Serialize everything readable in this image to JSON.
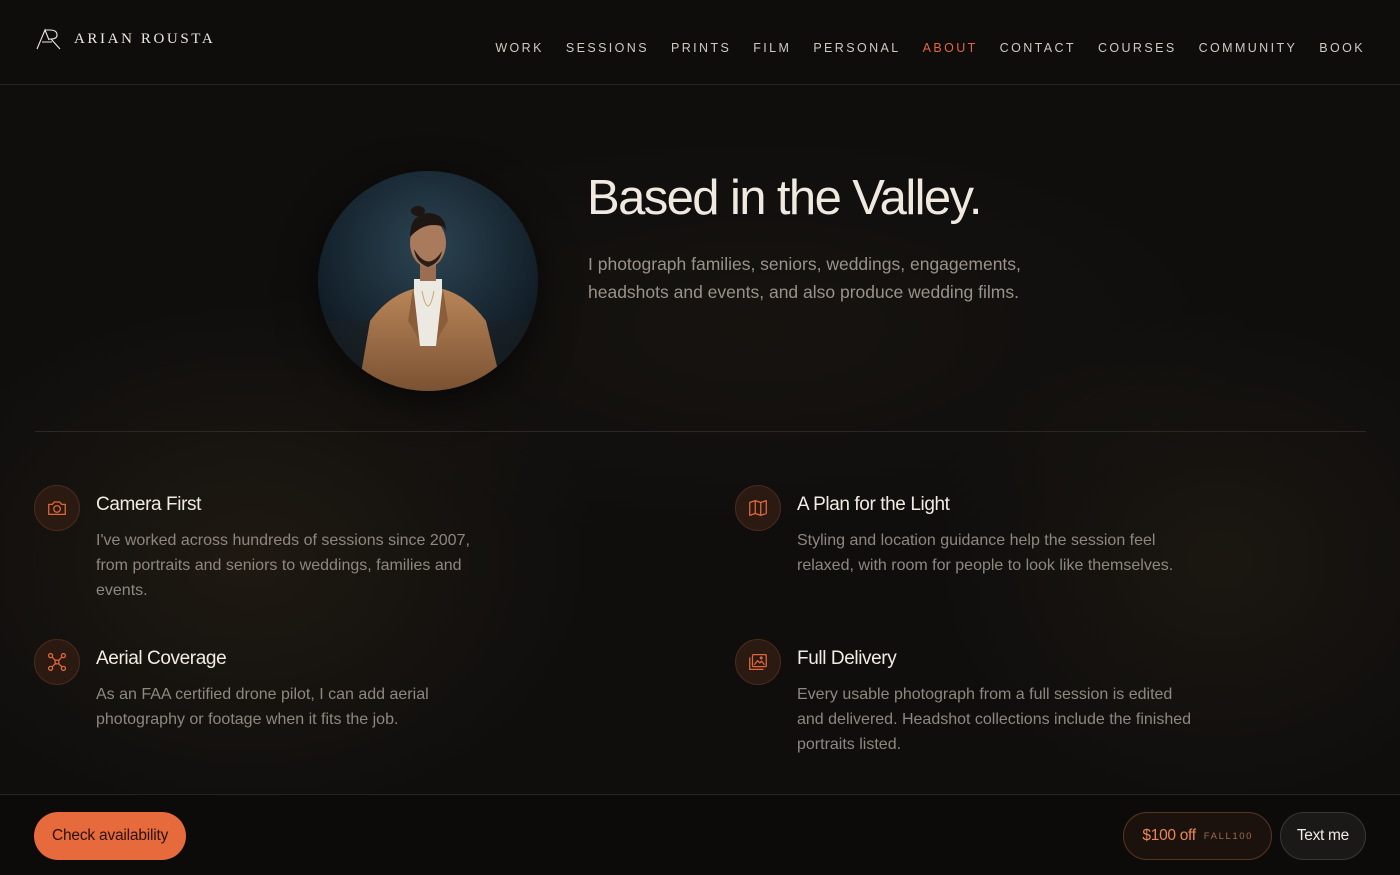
{
  "brand": {
    "name": "ARIAN ROUSTA",
    "logo_icon": "ar-monogram-icon"
  },
  "nav": {
    "items": [
      {
        "label": "WORK",
        "active": false
      },
      {
        "label": "SESSIONS",
        "active": false
      },
      {
        "label": "PRINTS",
        "active": false
      },
      {
        "label": "FILM",
        "active": false
      },
      {
        "label": "PERSONAL",
        "active": false
      },
      {
        "label": "ABOUT",
        "active": true
      },
      {
        "label": "CONTACT",
        "active": false
      },
      {
        "label": "COURSES",
        "active": false
      },
      {
        "label": "COMMUNITY",
        "active": false
      },
      {
        "label": "BOOK",
        "active": false
      }
    ],
    "active_color": "#e3673a"
  },
  "hero": {
    "title": "Based in the Valley.",
    "text": "I photograph families, seniors, weddings, engagements, headshots and events, and also produce wedding films."
  },
  "features": [
    {
      "icon": "camera-icon",
      "title": "Camera First",
      "text": "I've worked across hundreds of sessions since 2007, from portraits and seniors to weddings, families and events."
    },
    {
      "icon": "map-icon",
      "title": "A Plan for the Light",
      "text": "Styling and location guidance help the session feel relaxed, with room for people to look like themselves."
    },
    {
      "icon": "drone-icon",
      "title": "Aerial Coverage",
      "text": "As an FAA certified drone pilot, I can add aerial photography or footage when it fits the job."
    },
    {
      "icon": "gallery-icon",
      "title": "Full Delivery",
      "text": "Every usable photograph from a full session is edited and delivered. Headshot collections include the finished portraits listed."
    }
  ],
  "footer": {
    "cta_label": "Check availability",
    "promo_amount": "$100 off",
    "promo_code": "FALL100",
    "text_label": "Text me"
  },
  "colors": {
    "accent": "#e66a3c",
    "background": "#0f0e0d"
  }
}
